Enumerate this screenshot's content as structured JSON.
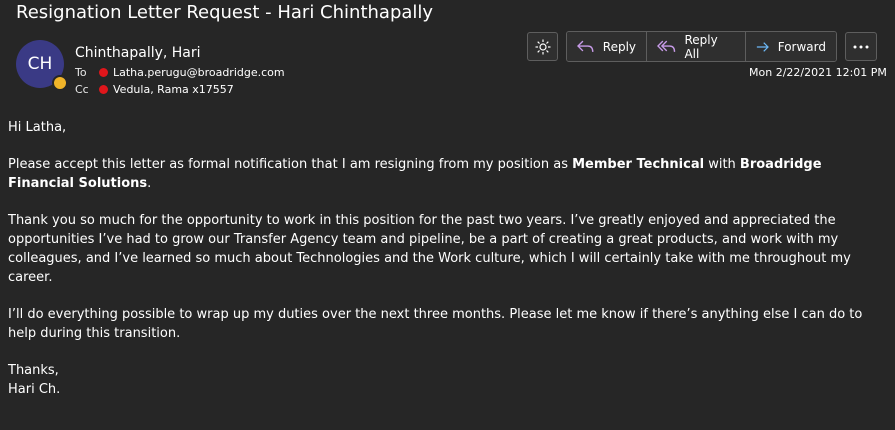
{
  "subject": "Resignation Letter Request - Hari Chinthapally",
  "sender": {
    "initials": "CH",
    "name": "Chinthapally, Hari",
    "presence_color": "#f0b429"
  },
  "recipients": {
    "to_label": "To",
    "to": "Latha.perugu@broadridge.com",
    "cc_label": "Cc",
    "cc": "Vedula, Rama x17557",
    "status_color": "#e0161b"
  },
  "toolbar": {
    "theme_icon": "sun-icon",
    "reply": "Reply",
    "reply_all": "Reply All",
    "forward": "Forward",
    "more_icon": "ellipsis-icon"
  },
  "date": "Mon 2/22/2021 12:01 PM",
  "body": {
    "greeting": "Hi Latha,",
    "p1_pre": "Please accept this letter as formal notification that I am resigning from my position as ",
    "p1_role": "Member Technical",
    "p1_mid": " with ",
    "p1_company": "Broadridge Financial Solutions",
    "p1_end": ".",
    "p2": "Thank you so much for the opportunity to work in this position for the past two years. I’ve greatly enjoyed and appreciated the opportunities I’ve had to grow our Transfer Agency team and pipeline, be a part of creating a great products, and work with my colleagues, and I’ve learned so much about Technologies and the Work culture, which I will certainly take with me throughout my career.",
    "p3": "I’ll do everything possible to wrap up my duties over the next three months. Please let me know if there’s anything else I can do to help during this transition.",
    "closing": "Thanks,",
    "signature": "Hari Ch."
  }
}
